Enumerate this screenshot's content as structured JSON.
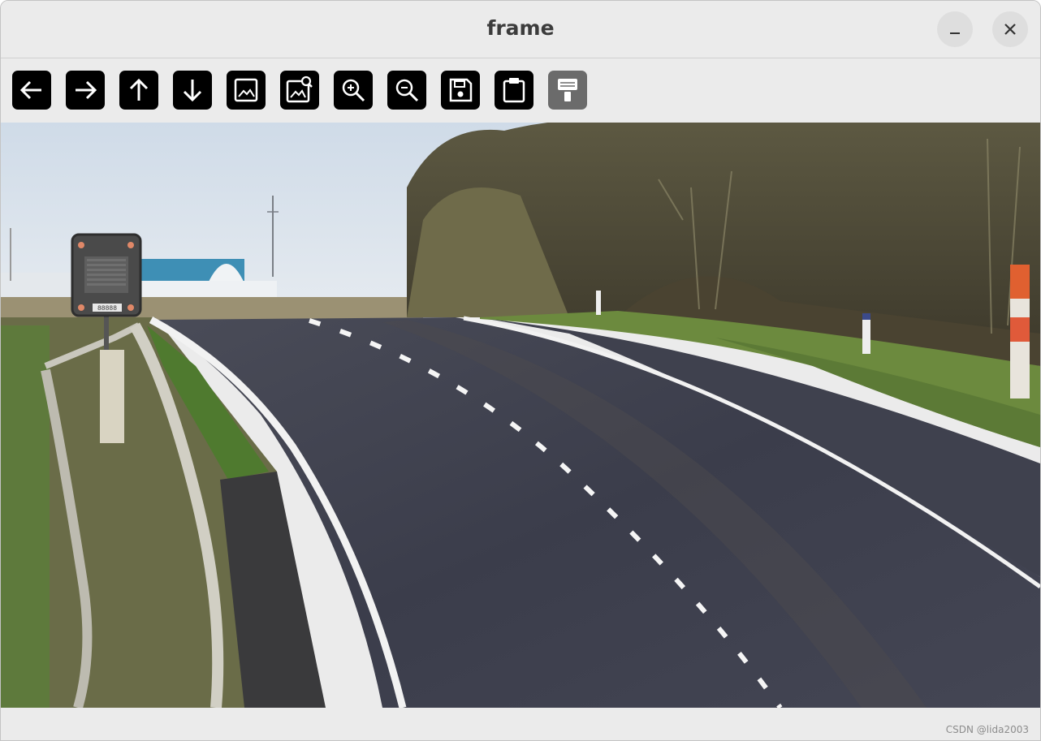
{
  "window": {
    "title": "frame",
    "controls": {
      "minimize_icon": "minimize-icon",
      "close_icon": "close-icon"
    }
  },
  "toolbar": {
    "buttons": [
      {
        "name": "pan-left",
        "icon": "arrow-left-icon",
        "enabled": true
      },
      {
        "name": "pan-right",
        "icon": "arrow-right-icon",
        "enabled": true
      },
      {
        "name": "pan-up",
        "icon": "arrow-up-icon",
        "enabled": true
      },
      {
        "name": "pan-down",
        "icon": "arrow-down-icon",
        "enabled": true
      },
      {
        "name": "zoom-fit",
        "icon": "image-icon",
        "enabled": true
      },
      {
        "name": "zoom-original",
        "icon": "image-search-icon",
        "enabled": true
      },
      {
        "name": "zoom-in",
        "icon": "zoom-in-icon",
        "enabled": true
      },
      {
        "name": "zoom-out",
        "icon": "zoom-out-icon",
        "enabled": true
      },
      {
        "name": "save",
        "icon": "save-icon",
        "enabled": true
      },
      {
        "name": "copy",
        "icon": "clipboard-icon",
        "enabled": true
      },
      {
        "name": "properties",
        "icon": "paint-brush-icon",
        "enabled": false
      }
    ]
  },
  "image": {
    "description_icon": "road-photo",
    "sign_text": "88888"
  },
  "statusbar": {
    "watermark": "CSDN @lida2003"
  },
  "colors": {
    "window_bg": "#ebebeb",
    "button_bg": "#000000",
    "button_disabled_bg": "#6b6b6b",
    "title_color": "#3c3c3c"
  }
}
